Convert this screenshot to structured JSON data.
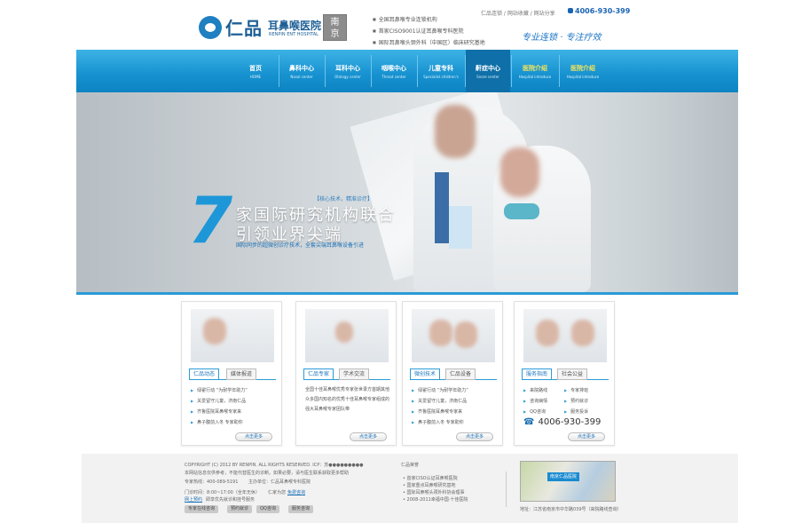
{
  "header": {
    "brand_cn": "仁品",
    "brand_hospital": "耳鼻喉医院",
    "brand_en": "RENPIN ENT HOSPITAL",
    "city_line1": "南",
    "city_line2": "京",
    "highlights": [
      "全国耳鼻喉专业连锁机构",
      "首家CISO9001认证耳鼻喉专科医院",
      "国际耳鼻喉头颈外科（中国区）临床研究基地"
    ],
    "toplinks": "仁品连锁 / 网站收藏 / 网站分享",
    "phone": "4006-930-399",
    "slogan": "专业连锁 · 专注疗效"
  },
  "nav": {
    "items": [
      {
        "cn": "首页",
        "en": "HOME"
      },
      {
        "cn": "鼻科中心",
        "en": "Nasal center"
      },
      {
        "cn": "耳科中心",
        "en": "Otology center"
      },
      {
        "cn": "咽喉中心",
        "en": "Throat center"
      },
      {
        "cn": "儿童专科",
        "en": "Specialist children's"
      },
      {
        "cn": "鼾症中心",
        "en": "Snore center"
      },
      {
        "cn": "医院介绍",
        "en": "Hospital introduce"
      },
      {
        "cn": "医院介绍",
        "en": "Hospital introduce"
      }
    ]
  },
  "banner": {
    "big_number": "7",
    "sub_tag": "【核心技术，精准诊疗】",
    "line1": "家国际研究机构联合",
    "line2": "引领业界尖端",
    "small": "国际同步的超微创诊疗技术，全套尖端耳鼻喉设备引进"
  },
  "cards": [
    {
      "tab1": "仁品动态",
      "tab2": "媒体报道",
      "items": [
        "绿翟行动 “为耐学年助力”",
        "关爱留守儿童，济南仁品",
        "齐鲁医院耳鼻喉专家来",
        "鼻子腹前入冬 专家助你"
      ],
      "more": "点击更多"
    },
    {
      "tab1": "仁品专家",
      "tab2": "学术交流",
      "para": "全国十佳耳鼻喉优秀专家张世录方首期其他众多国内知名的优秀十佳耳鼻喉专家组成的强大耳鼻喉专家团队带",
      "more": "点击更多"
    },
    {
      "tab1": "微创技术",
      "tab2": "仁品设备",
      "items": [
        "绿翟行动 “为耐学年助力”",
        "关爱留守儿童，济南仁品",
        "齐鲁医院耳鼻喉专家来",
        "鼻子腹前入冬 专家助你"
      ],
      "more": "点击更多"
    },
    {
      "tab1": "服务指南",
      "tab2": "社会公益",
      "items_left": [
        "来院路线",
        "咨询病情",
        "QQ咨询"
      ],
      "items_right": [
        "专家排班",
        "预约就诊",
        "服务投诉"
      ],
      "phone": "4006-930-399",
      "more": "点击更多"
    }
  ],
  "footer": {
    "copyright": "COPYRIGHT (C) 2012 BY RENPIN. ALL RIGHTS RESERVED. ICP：苏●●●●●●●●●",
    "notice": "本网站信息仅供参考，不能代替医生的诊断。如果必要，请与医生联系获取更多帮助",
    "hotline": "专家热线：400-089-5191",
    "sponsor": "主办单位：仁品耳鼻喉专科医院",
    "hours": "门诊时间：8:00~17:00（全年无休）",
    "reply_label": "仁家为您",
    "reply_link": "免费咨询",
    "online_link": "网上预约",
    "online_text": "即享优先就诊和挂号服务",
    "buttons": [
      "专家在线咨询",
      "预约就诊",
      "QQ咨询",
      "服务咨询"
    ],
    "honors_title": "仁品荣誉",
    "honors": [
      "首家CISO认证耳鼻喉医院",
      "国家重点耳鼻喉研究基地",
      "国际耳鼻喉头颈外科协会理事",
      "2008-2011幸福中国·十佳医院"
    ],
    "map_label": "南京仁品医院",
    "address": "地址：江苏省南京市中华路039号（来院路线查询）"
  }
}
